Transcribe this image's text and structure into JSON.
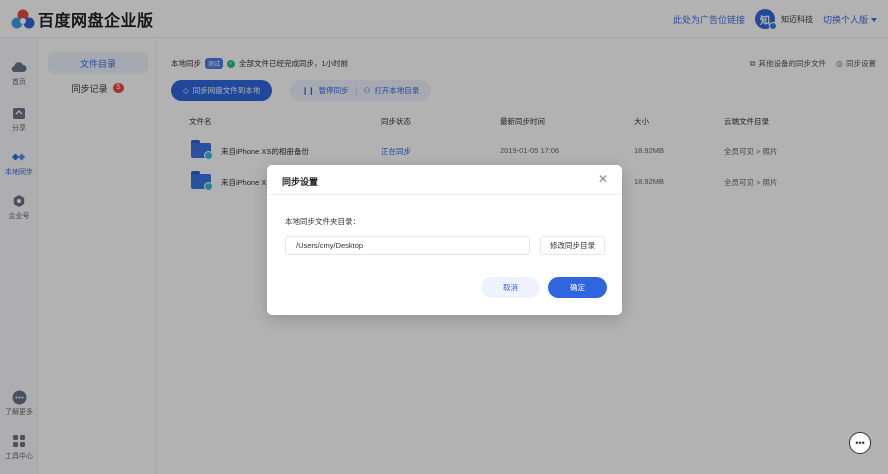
{
  "header": {
    "app_title": "百度网盘企业版",
    "ad_link": "此处为广告位链接",
    "avatar_char": "知",
    "company_name": "知迈科技",
    "switch_edition": "切换个人版"
  },
  "rail": {
    "items": [
      {
        "label": "首页",
        "icon": "cloud-icon"
      },
      {
        "label": "分享",
        "icon": "share-icon"
      },
      {
        "label": "本地同步",
        "icon": "sync-icon"
      },
      {
        "label": "企业号",
        "icon": "enterprise-icon"
      },
      {
        "label": "了解更多",
        "icon": "more-icon"
      },
      {
        "label": "工具中心",
        "icon": "tools-icon"
      }
    ]
  },
  "subnav": {
    "items": [
      {
        "label": "文件目录"
      },
      {
        "label": "同步记录",
        "badge": "5"
      }
    ]
  },
  "main": {
    "sync_title": "本地同步",
    "beta_tag": "测试",
    "sync_status": "全部文件已经完成同步，1小时前",
    "other_devices": "其他设备的同步文件",
    "sync_settings": "同步设置",
    "btn_sync_to_local": "同步网盘文件到本地",
    "btn_pause": "暂停同步",
    "btn_open_local": "打开本地目录",
    "table": {
      "headers": [
        "文件名",
        "同步状态",
        "最新同步时间",
        "大小",
        "云端文件目录"
      ],
      "rows": [
        {
          "name": "来自iPhone XS的相册备份",
          "status": "正在同步",
          "time": "2019-01-05 17:06",
          "size": "18.92MB",
          "cloud_dir": "全员可见 > 照片"
        },
        {
          "name": "来自iPhone X",
          "status": "",
          "time": "",
          "size": "18.92MB",
          "cloud_dir": "全员可见 > 照片"
        }
      ]
    }
  },
  "modal": {
    "title": "同步设置",
    "field_label": "本地同步文件夹目录：",
    "path_value": "/Users/cmy/Desktop",
    "modify_button": "修改同步目录",
    "cancel_button": "取消",
    "ok_button": "确定"
  },
  "colors": {
    "accent": "#2f66dd",
    "success": "#2ec07a",
    "badge": "#f04848"
  }
}
